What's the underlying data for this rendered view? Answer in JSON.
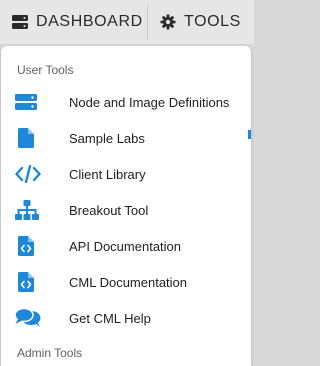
{
  "topbar": {
    "dashboard_label": "DASHBOARD",
    "tools_label": "TOOLS",
    "icons": [
      "server-icon",
      "gear-icon"
    ]
  },
  "menu": {
    "section_label": "User Tools",
    "items": [
      {
        "label": "Node and Image Definitions",
        "icon": "server-icon"
      },
      {
        "label": "Sample Labs",
        "icon": "file-icon"
      },
      {
        "label": "Client Library",
        "icon": "code-icon"
      },
      {
        "label": "Breakout Tool",
        "icon": "sitemap-icon"
      },
      {
        "label": "API Documentation",
        "icon": "file-code-icon"
      },
      {
        "label": "CML Documentation",
        "icon": "file-code-icon"
      },
      {
        "label": "Get CML Help",
        "icon": "comments-icon"
      }
    ],
    "next_section_label": "Admin Tools"
  },
  "colors": {
    "icon_blue": "#1e88d8",
    "topbar_bg": "#e6e6e6",
    "menu_bg": "#ffffff"
  }
}
